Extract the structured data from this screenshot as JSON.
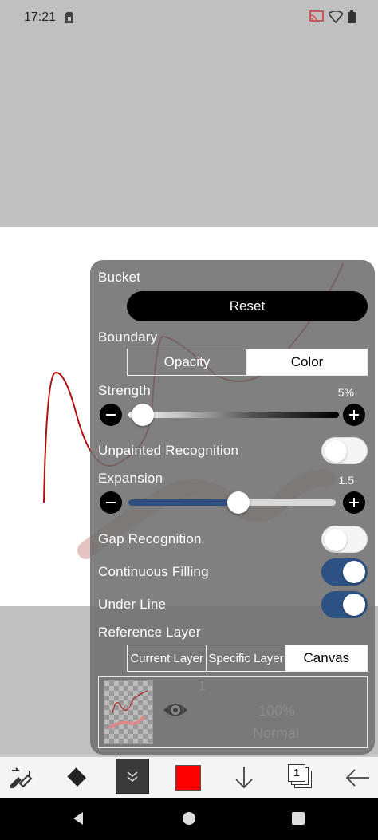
{
  "status": {
    "time": "17:21"
  },
  "panel": {
    "title": "Bucket",
    "reset_label": "Reset",
    "boundary": {
      "label": "Boundary",
      "options": [
        "Opacity",
        "Color"
      ],
      "selected": "Color"
    },
    "strength": {
      "label": "Strength",
      "value_text": "5%",
      "value": 0.05
    },
    "unpainted_recognition": {
      "label": "Unpainted Recognition",
      "on": false
    },
    "expansion": {
      "label": "Expansion",
      "value_text": "1.5",
      "fraction": 0.53
    },
    "gap_recognition": {
      "label": "Gap Recognition",
      "on": false
    },
    "continuous_filling": {
      "label": "Continuous Filling",
      "on": true
    },
    "under_line": {
      "label": "Under Line",
      "on": true
    },
    "reference_layer": {
      "label": "Reference Layer",
      "options": [
        "Current Layer",
        "Specific Layer",
        "Canvas"
      ],
      "selected": "Canvas"
    },
    "layer": {
      "number": "1",
      "opacity": "100%",
      "blend": "Normal"
    }
  },
  "toolbar": {
    "items": [
      "brush-eraser-swap-icon",
      "fill-bucket-icon",
      "collapse-chevron-icon",
      "color-swatch",
      "arrow-down-icon",
      "layers-icon",
      "back-arrow-icon"
    ],
    "layer_count": "1",
    "current_color": "#ff0000"
  },
  "colors": {
    "accent": "#2c5183",
    "stroke": "#b01010"
  }
}
